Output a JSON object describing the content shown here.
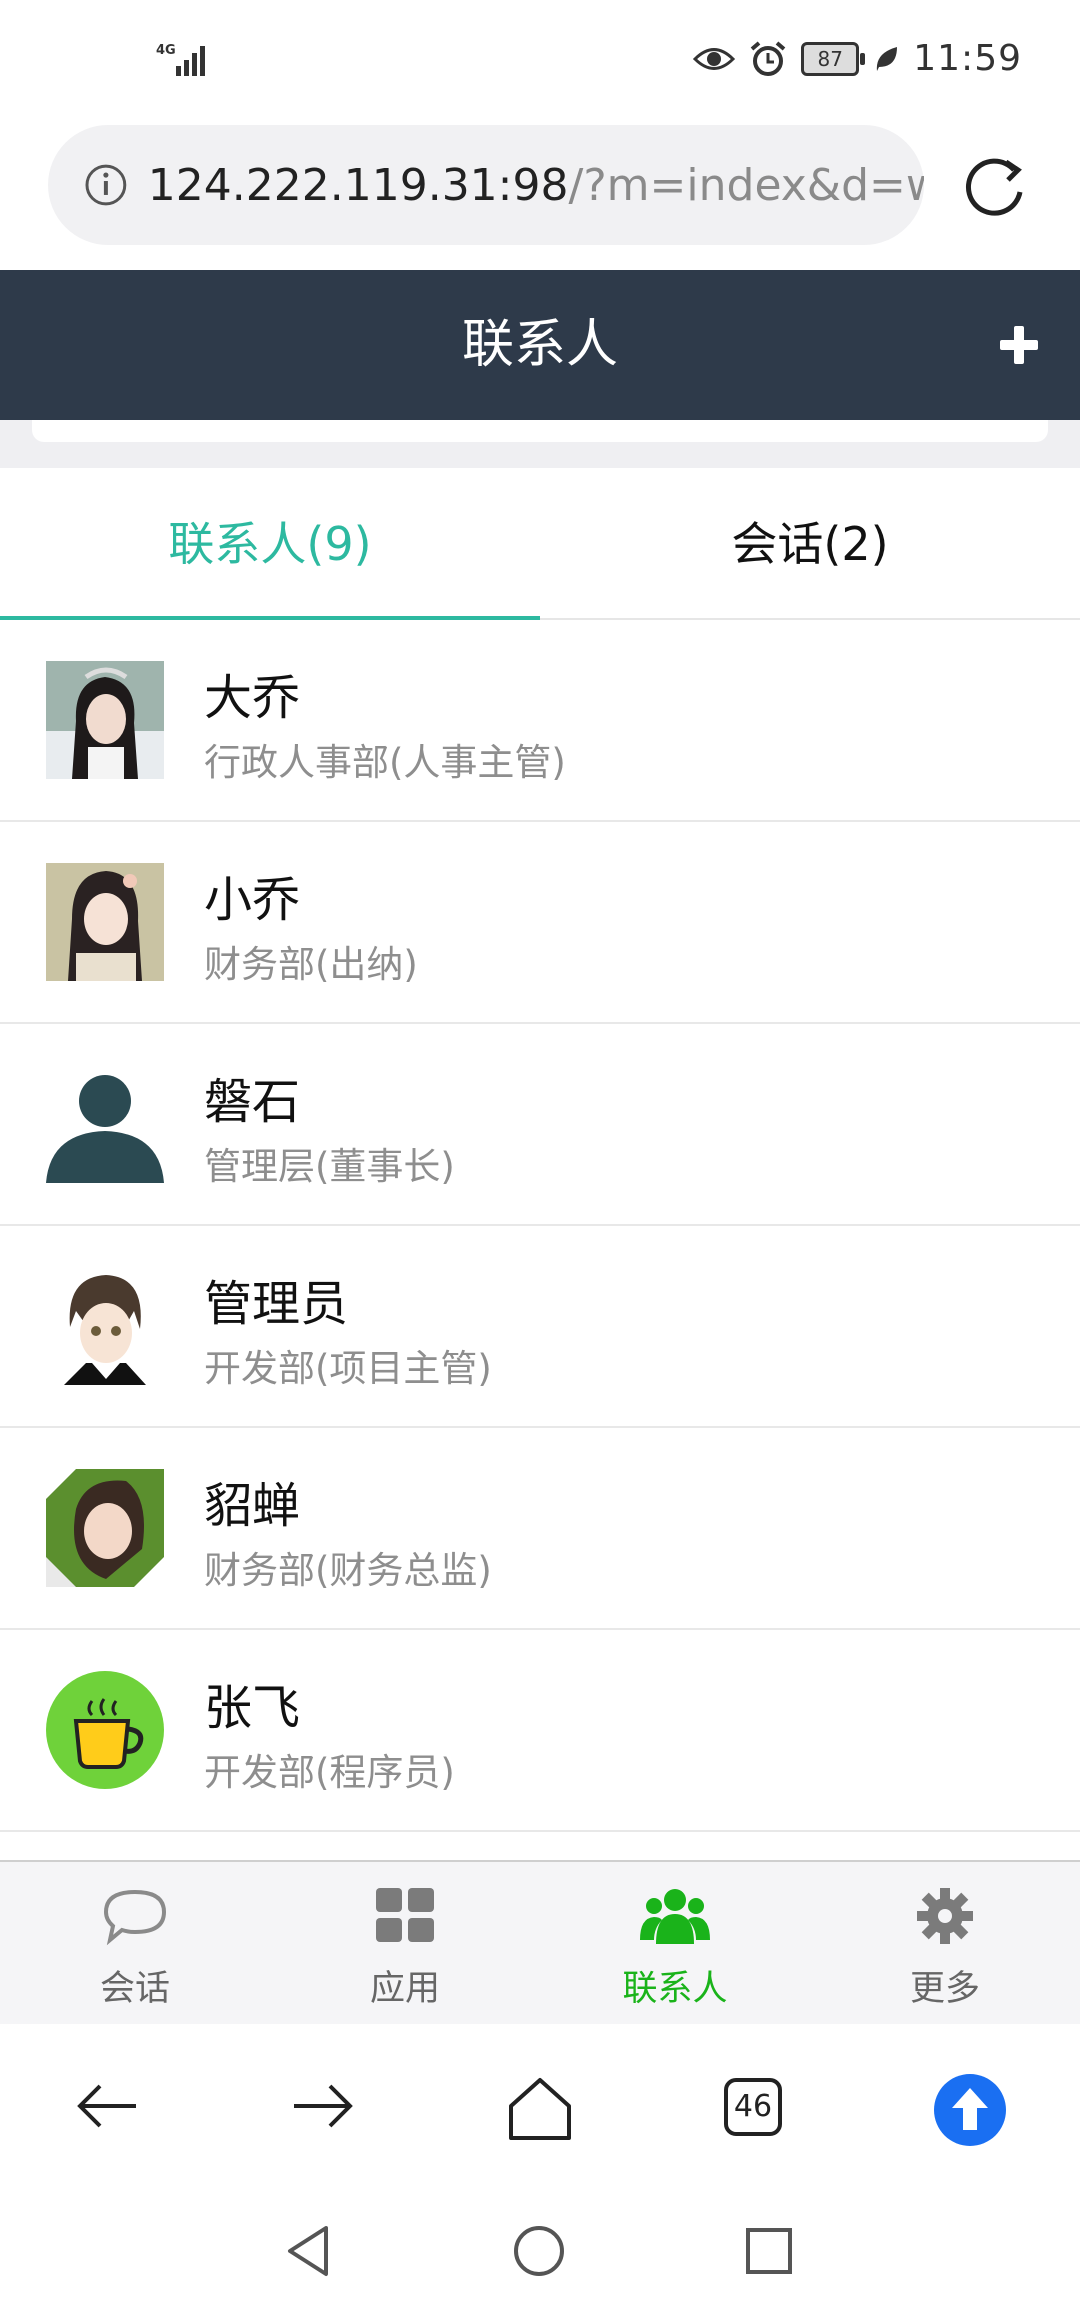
{
  "status_bar": {
    "network": "4G",
    "battery": "87",
    "time": "11:59"
  },
  "browser": {
    "url_main": "124.222.119.31:98",
    "url_rest": "/?m=index&d=w"
  },
  "header": {
    "title": "联系人"
  },
  "tabs": [
    {
      "label": "联系人(9)",
      "active": true
    },
    {
      "label": "会话(2)",
      "active": false
    }
  ],
  "contacts": [
    {
      "name": "大乔",
      "dept": "行政人事部(人事主管)"
    },
    {
      "name": "小乔",
      "dept": "财务部(出纳)"
    },
    {
      "name": "磐石",
      "dept": "管理层(董事长)"
    },
    {
      "name": "管理员",
      "dept": "开发部(项目主管)"
    },
    {
      "name": "貂蝉",
      "dept": "财务部(财务总监)"
    },
    {
      "name": "张飞",
      "dept": "开发部(程序员)"
    }
  ],
  "nav": [
    {
      "label": "会话",
      "icon": "chat-icon"
    },
    {
      "label": "应用",
      "icon": "apps-grid-icon"
    },
    {
      "label": "联系人",
      "icon": "contacts-icon",
      "active": true
    },
    {
      "label": "更多",
      "icon": "gear-icon"
    }
  ],
  "browser_toolbar": {
    "tab_count": "46"
  },
  "colors": {
    "header_bg": "#2e3a4a",
    "accent_teal": "#2db9a0",
    "nav_active": "#1ab31a",
    "upload_blue": "#1a6ff2"
  }
}
